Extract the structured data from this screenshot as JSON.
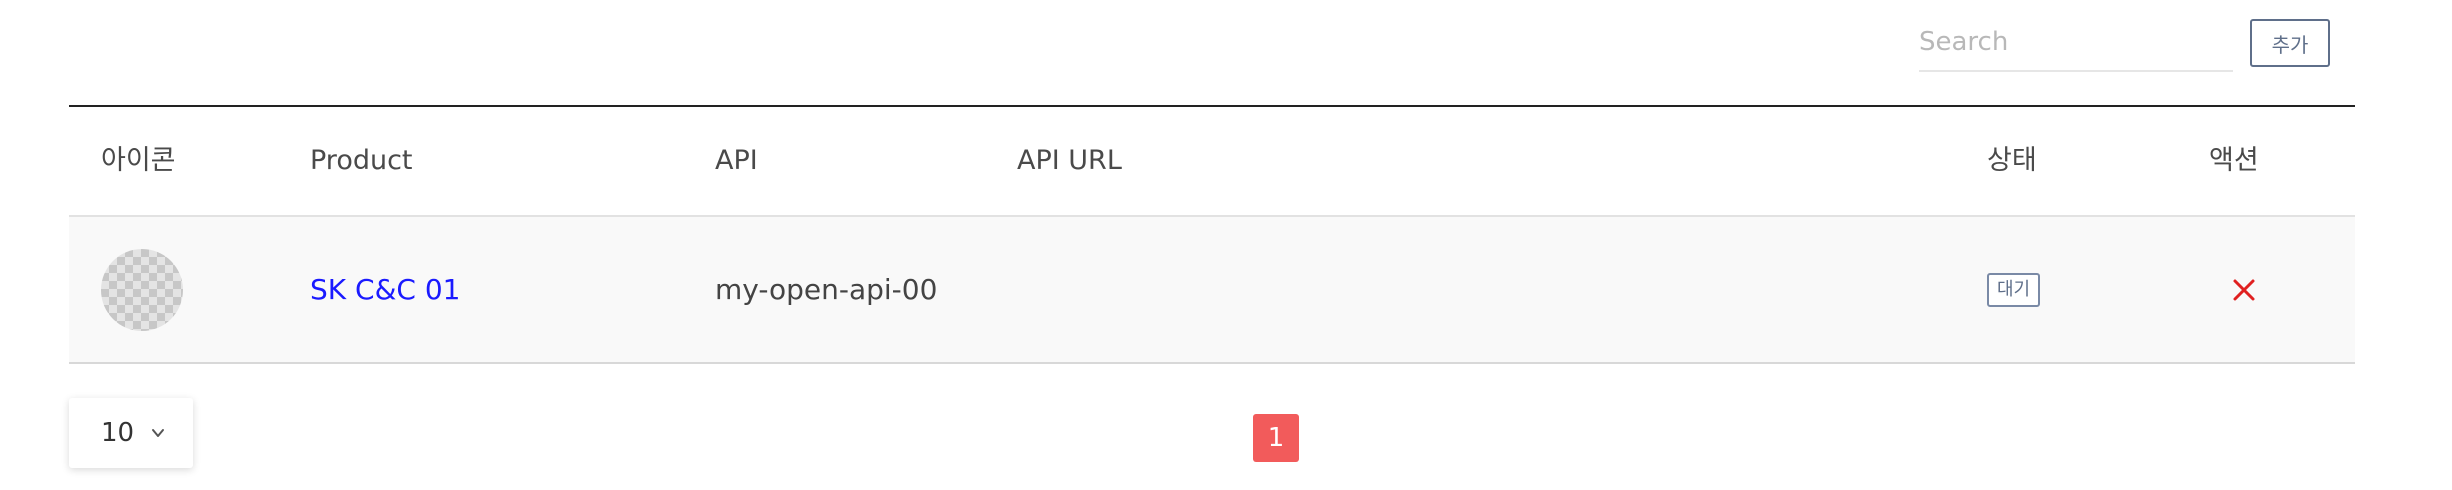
{
  "toolbar": {
    "search_placeholder": "Search",
    "search_value": "",
    "add_label": "추가"
  },
  "table": {
    "columns": [
      "아이콘",
      "Product",
      "API",
      "API URL",
      "상태",
      "액션"
    ],
    "rows": [
      {
        "icon": "placeholder-avatar-icon",
        "product": "SK C&C 01",
        "api": "my-open-api-00",
        "api_url": "",
        "status": "대기",
        "action_icon": "close-icon"
      }
    ]
  },
  "footer": {
    "page_size": "10",
    "current_page": "1"
  },
  "colors": {
    "link": "#1a1aff",
    "delete": "#e02020",
    "active_page": "#f25b5b",
    "status_border": "#7a8aa6"
  }
}
